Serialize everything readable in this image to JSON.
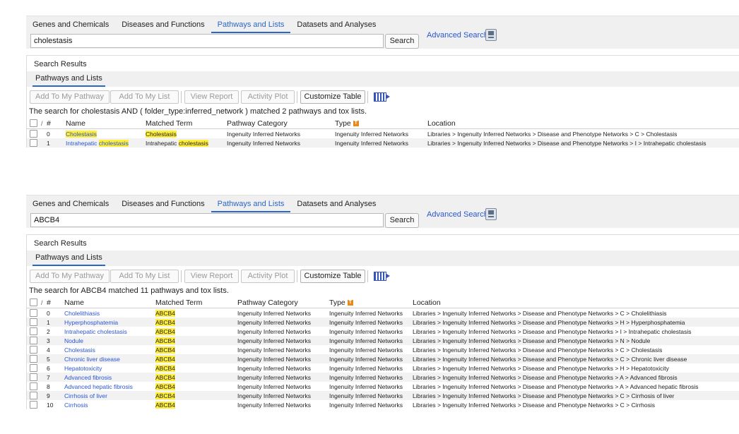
{
  "panels": [
    {
      "tabs": [
        {
          "label": "Genes and Chemicals",
          "active": false
        },
        {
          "label": "Diseases and Functions",
          "active": false
        },
        {
          "label": "Pathways and Lists",
          "active": true
        },
        {
          "label": "Datasets and Analyses",
          "active": false
        }
      ],
      "search_value": "cholestasis",
      "search_label": "Search",
      "advanced_label": "Advanced Search",
      "results_title": "Search Results",
      "subtab_label": "Pathways and Lists",
      "toolbar": {
        "add_pathway": "Add To My Pathway",
        "add_list": "Add To My List",
        "view_report": "View Report",
        "activity_plot": "Activity Plot",
        "customize": "Customize Table"
      },
      "summary": "The search for cholestasis AND ( folder_type:inferred_network ) matched 2 pathways and tox lists.",
      "columns": {
        "num": "#",
        "name": "Name",
        "term": "Matched Term",
        "category": "Pathway Category",
        "type": "Type",
        "location": "Location"
      },
      "type_badge": "T",
      "rows": [
        {
          "n": "0",
          "name_parts": [
            {
              "t": "Cholestasis",
              "hl": true
            }
          ],
          "term_parts": [
            {
              "t": "Cholestasis",
              "hl": true
            }
          ],
          "category": "Ingenuity Inferred Networks",
          "type": "Ingenuity Inferred Networks",
          "location": "Libraries > Ingenuity Inferred Networks > Disease and Phenotype Networks > C > Cholestasis"
        },
        {
          "n": "1",
          "name_parts": [
            {
              "t": "Intrahepatic ",
              "hl": false
            },
            {
              "t": "cholestasis",
              "hl": true
            }
          ],
          "term_parts": [
            {
              "t": "Intrahepatic ",
              "hl": false
            },
            {
              "t": "cholestasis",
              "hl": true
            }
          ],
          "category": "Ingenuity Inferred Networks",
          "type": "Ingenuity Inferred Networks",
          "location": "Libraries > Ingenuity Inferred Networks > Disease and Phenotype Networks > I > Intrahepatic cholestasis"
        }
      ]
    },
    {
      "tabs": [
        {
          "label": "Genes and Chemicals",
          "active": false
        },
        {
          "label": "Diseases and Functions",
          "active": false
        },
        {
          "label": "Pathways and Lists",
          "active": true
        },
        {
          "label": "Datasets and Analyses",
          "active": false
        }
      ],
      "search_value": "ABCB4",
      "search_label": "Search",
      "advanced_label": "Advanced Search",
      "results_title": "Search Results",
      "subtab_label": "Pathways and Lists",
      "toolbar": {
        "add_pathway": "Add To My Pathway",
        "add_list": "Add To My List",
        "view_report": "View Report",
        "activity_plot": "Activity Plot",
        "customize": "Customize Table"
      },
      "summary": "The search for ABCB4 matched 11 pathways and tox lists.",
      "columns": {
        "num": "#",
        "name": "Name",
        "term": "Matched Term",
        "category": "Pathway Category",
        "type": "Type",
        "location": "Location"
      },
      "type_badge": "T",
      "rows": [
        {
          "n": "0",
          "name_parts": [
            {
              "t": "Cholelithiasis",
              "hl": false
            }
          ],
          "term_parts": [
            {
              "t": "ABCB4",
              "hl": true
            }
          ],
          "category": "Ingenuity Inferred Networks",
          "type": "Ingenuity Inferred Networks",
          "location": "Libraries > Ingenuity Inferred Networks > Disease and Phenotype Networks > C > Cholelithiasis"
        },
        {
          "n": "1",
          "name_parts": [
            {
              "t": "Hyperphosphatemia",
              "hl": false
            }
          ],
          "term_parts": [
            {
              "t": "ABCB4",
              "hl": true
            }
          ],
          "category": "Ingenuity Inferred Networks",
          "type": "Ingenuity Inferred Networks",
          "location": "Libraries > Ingenuity Inferred Networks > Disease and Phenotype Networks > H > Hyperphosphatemia"
        },
        {
          "n": "2",
          "name_parts": [
            {
              "t": "Intrahepatic cholestasis",
              "hl": false
            }
          ],
          "term_parts": [
            {
              "t": "ABCB4",
              "hl": true
            }
          ],
          "category": "Ingenuity Inferred Networks",
          "type": "Ingenuity Inferred Networks",
          "location": "Libraries > Ingenuity Inferred Networks > Disease and Phenotype Networks > I > Intrahepatic cholestasis"
        },
        {
          "n": "3",
          "name_parts": [
            {
              "t": "Nodule",
              "hl": false
            }
          ],
          "term_parts": [
            {
              "t": "ABCB4",
              "hl": true
            }
          ],
          "category": "Ingenuity Inferred Networks",
          "type": "Ingenuity Inferred Networks",
          "location": "Libraries > Ingenuity Inferred Networks > Disease and Phenotype Networks > N > Nodule"
        },
        {
          "n": "4",
          "name_parts": [
            {
              "t": "Cholestasis",
              "hl": false
            }
          ],
          "term_parts": [
            {
              "t": "ABCB4",
              "hl": true
            }
          ],
          "category": "Ingenuity Inferred Networks",
          "type": "Ingenuity Inferred Networks",
          "location": "Libraries > Ingenuity Inferred Networks > Disease and Phenotype Networks > C > Cholestasis"
        },
        {
          "n": "5",
          "name_parts": [
            {
              "t": "Chronic liver disease",
              "hl": false
            }
          ],
          "term_parts": [
            {
              "t": "ABCB4",
              "hl": true
            }
          ],
          "category": "Ingenuity Inferred Networks",
          "type": "Ingenuity Inferred Networks",
          "location": "Libraries > Ingenuity Inferred Networks > Disease and Phenotype Networks > C > Chronic liver disease"
        },
        {
          "n": "6",
          "name_parts": [
            {
              "t": "Hepatotoxicity",
              "hl": false
            }
          ],
          "term_parts": [
            {
              "t": "ABCB4",
              "hl": true
            }
          ],
          "category": "Ingenuity Inferred Networks",
          "type": "Ingenuity Inferred Networks",
          "location": "Libraries > Ingenuity Inferred Networks > Disease and Phenotype Networks > H > Hepatotoxicity"
        },
        {
          "n": "7",
          "name_parts": [
            {
              "t": "Advanced fibrosis",
              "hl": false
            }
          ],
          "term_parts": [
            {
              "t": "ABCB4",
              "hl": true
            }
          ],
          "category": "Ingenuity Inferred Networks",
          "type": "Ingenuity Inferred Networks",
          "location": "Libraries > Ingenuity Inferred Networks > Disease and Phenotype Networks > A > Advanced fibrosis"
        },
        {
          "n": "8",
          "name_parts": [
            {
              "t": "Advanced hepatic fibrosis",
              "hl": false
            }
          ],
          "term_parts": [
            {
              "t": "ABCB4",
              "hl": true
            }
          ],
          "category": "Ingenuity Inferred Networks",
          "type": "Ingenuity Inferred Networks",
          "location": "Libraries > Ingenuity Inferred Networks > Disease and Phenotype Networks > A > Advanced hepatic fibrosis"
        },
        {
          "n": "9",
          "name_parts": [
            {
              "t": "Cirrhosis of liver",
              "hl": false
            }
          ],
          "term_parts": [
            {
              "t": "ABCB4",
              "hl": true
            }
          ],
          "category": "Ingenuity Inferred Networks",
          "type": "Ingenuity Inferred Networks",
          "location": "Libraries > Ingenuity Inferred Networks > Disease and Phenotype Networks > C > Cirrhosis of liver"
        },
        {
          "n": "10",
          "name_parts": [
            {
              "t": "Cirrhosis",
              "hl": false
            }
          ],
          "term_parts": [
            {
              "t": "ABCB4",
              "hl": true
            }
          ],
          "category": "Ingenuity Inferred Networks",
          "type": "Ingenuity Inferred Networks",
          "location": "Libraries > Ingenuity Inferred Networks > Disease and Phenotype Networks > C > Cirrhosis"
        }
      ]
    }
  ]
}
